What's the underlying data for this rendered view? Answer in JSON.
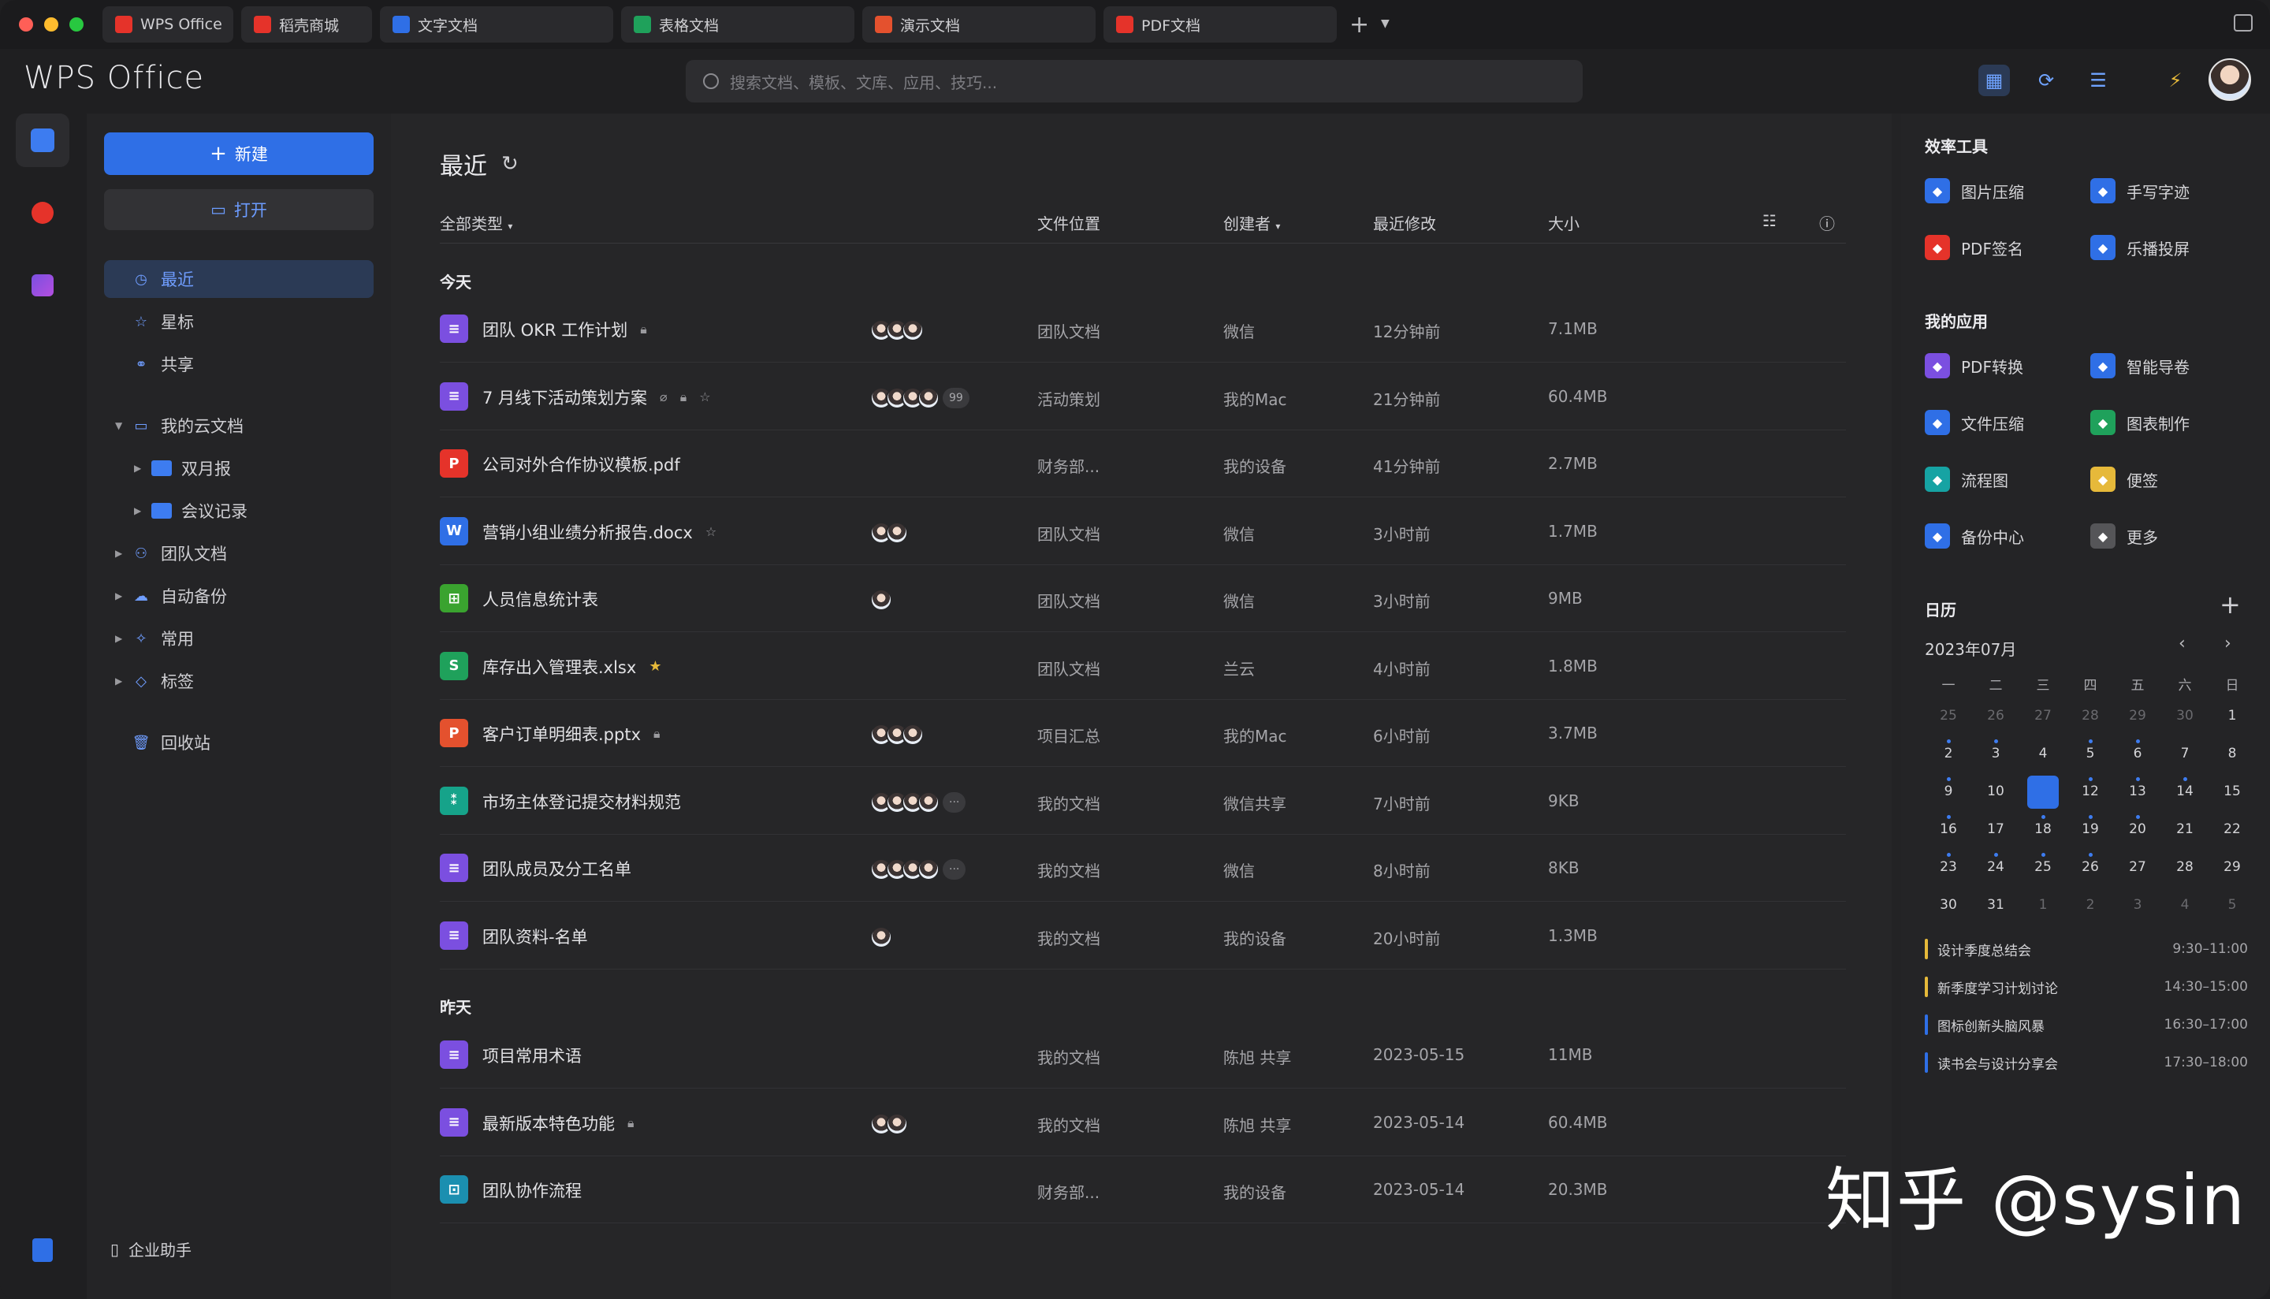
{
  "tabs": [
    {
      "label": "WPS Office",
      "icon": "wps-logo-icon",
      "color": "#e5332a"
    },
    {
      "label": "稻壳商城",
      "icon": "docer-icon",
      "color": "#e5332a"
    },
    {
      "label": "文字文档",
      "icon": "word-doc-icon",
      "color": "#2f6fe6"
    },
    {
      "label": "表格文档",
      "icon": "sheet-doc-icon",
      "color": "#1fa15b"
    },
    {
      "label": "演示文档",
      "icon": "slides-doc-icon",
      "color": "#e4512e"
    },
    {
      "label": "PDF文档",
      "icon": "pdf-doc-icon",
      "color": "#e5332a"
    }
  ],
  "header": {
    "logo": "WPS Office",
    "search_placeholder": "搜索文档、模板、文库、应用、技巧..."
  },
  "sidebar": {
    "new_label": "新建",
    "open_label": "打开",
    "items": {
      "recent": "最近",
      "starred": "星标",
      "shared": "共享",
      "cloud": "我的云文档",
      "weekly": "双月报",
      "meeting": "会议记录",
      "team": "团队文档",
      "backup": "自动备份",
      "common": "常用",
      "tags": "标签",
      "trash": "回收站"
    },
    "enterprise": "企业助手"
  },
  "main": {
    "title": "最近",
    "columns": {
      "type": "全部类型",
      "location": "文件位置",
      "creator": "创建者",
      "modified": "最近修改",
      "size": "大小"
    },
    "group_today": "今天",
    "group_yesterday": "昨天",
    "today": [
      {
        "name": "团队 OKR 工作计划",
        "type": "doc",
        "loc": "团队文档",
        "creator": "微信",
        "time": "12分钟前",
        "size": "7.1MB",
        "avatars": 3,
        "more": "",
        "lock": true,
        "clip": false,
        "star": false,
        "starFilled": false
      },
      {
        "name": "7 月线下活动策划方案",
        "type": "doc",
        "loc": "活动策划",
        "creator": "我的Mac",
        "time": "21分钟前",
        "size": "60.4MB",
        "avatars": 4,
        "more": "99",
        "lock": true,
        "clip": true,
        "star": true,
        "starFilled": false
      },
      {
        "name": "公司对外合作协议模板.pdf",
        "type": "pdf",
        "loc": "财务部...",
        "creator": "我的设备",
        "time": "41分钟前",
        "size": "2.7MB",
        "avatars": 0,
        "more": "",
        "lock": false,
        "clip": false,
        "star": false,
        "starFilled": false
      },
      {
        "name": "营销小组业绩分析报告.docx",
        "type": "word",
        "loc": "团队文档",
        "creator": "微信",
        "time": "3小时前",
        "size": "1.7MB",
        "avatars": 2,
        "more": "",
        "lock": false,
        "clip": false,
        "star": true,
        "starFilled": false
      },
      {
        "name": "人员信息统计表",
        "type": "form",
        "loc": "团队文档",
        "creator": "微信",
        "time": "3小时前",
        "size": "9MB",
        "avatars": 1,
        "more": "",
        "lock": false,
        "clip": false,
        "star": false,
        "starFilled": false
      },
      {
        "name": "库存出入管理表.xlsx",
        "type": "sheet",
        "loc": "团队文档",
        "creator": "兰云",
        "time": "4小时前",
        "size": "1.8MB",
        "avatars": 0,
        "more": "",
        "lock": false,
        "clip": false,
        "star": true,
        "starFilled": true
      },
      {
        "name": "客户订单明细表.pptx",
        "type": "ppt",
        "loc": "项目汇总",
        "creator": "我的Mac",
        "time": "6小时前",
        "size": "3.7MB",
        "avatars": 3,
        "more": "",
        "lock": true,
        "clip": false,
        "star": false,
        "starFilled": false
      },
      {
        "name": "市场主体登记提交材料规范",
        "type": "mind",
        "loc": "我的文档",
        "creator": "微信共享",
        "time": "7小时前",
        "size": "9KB",
        "avatars": 4,
        "more": "···",
        "lock": false,
        "clip": false,
        "star": false,
        "starFilled": false
      },
      {
        "name": "团队成员及分工名单",
        "type": "doc",
        "loc": "我的文档",
        "creator": "微信",
        "time": "8小时前",
        "size": "8KB",
        "avatars": 4,
        "more": "···",
        "lock": false,
        "clip": false,
        "star": false,
        "starFilled": false
      },
      {
        "name": "团队资料-名单",
        "type": "doc",
        "loc": "我的文档",
        "creator": "我的设备",
        "time": "20小时前",
        "size": "1.3MB",
        "avatars": 1,
        "more": "",
        "lock": false,
        "clip": false,
        "star": false,
        "starFilled": false
      }
    ],
    "yesterday": [
      {
        "name": "项目常用术语",
        "type": "doc",
        "loc": "我的文档",
        "creator": "陈旭 共享",
        "time": "2023-05-15",
        "size": "11MB",
        "avatars": 0,
        "more": "",
        "lock": false,
        "clip": false,
        "star": false,
        "starFilled": false
      },
      {
        "name": "最新版本特色功能",
        "type": "doc",
        "loc": "我的文档",
        "creator": "陈旭 共享",
        "time": "2023-05-14",
        "size": "60.4MB",
        "avatars": 2,
        "more": "",
        "lock": true,
        "clip": false,
        "star": false,
        "starFilled": false
      },
      {
        "name": "团队协作流程",
        "type": "flow",
        "loc": "财务部...",
        "creator": "我的设备",
        "time": "2023-05-14",
        "size": "20.3MB",
        "avatars": 0,
        "more": "",
        "lock": false,
        "clip": false,
        "star": false,
        "starFilled": false
      }
    ]
  },
  "right": {
    "efficiency_title": "效率工具",
    "efficiency": [
      {
        "label": "图片压缩",
        "icon": "image-compress-icon",
        "color": "#2f6fe6"
      },
      {
        "label": "手写字迹",
        "icon": "handwriting-icon",
        "color": "#2f6fe6"
      },
      {
        "label": "PDF签名",
        "icon": "pdf-sign-icon",
        "color": "#e5332a"
      },
      {
        "label": "乐播投屏",
        "icon": "screen-cast-icon",
        "color": "#2f6fe6"
      }
    ],
    "apps_title": "我的应用",
    "apps": [
      {
        "label": "PDF转换",
        "icon": "pdf-convert-icon",
        "color": "#7b4fe0"
      },
      {
        "label": "智能导卷",
        "icon": "smart-import-icon",
        "color": "#2f6fe6"
      },
      {
        "label": "文件压缩",
        "icon": "file-compress-icon",
        "color": "#2f6fe6"
      },
      {
        "label": "图表制作",
        "icon": "chart-make-icon",
        "color": "#1fa15b"
      },
      {
        "label": "流程图",
        "icon": "flowchart-icon",
        "color": "#16a3a3"
      },
      {
        "label": "便签",
        "icon": "sticky-note-icon",
        "color": "#e6b93a"
      },
      {
        "label": "备份中心",
        "icon": "backup-center-icon",
        "color": "#2f6fe6"
      },
      {
        "label": "更多",
        "icon": "more-apps-icon",
        "color": "#555558"
      }
    ],
    "calendar_title": "日历",
    "month": "2023年07月",
    "weekdays": [
      "一",
      "二",
      "三",
      "四",
      "五",
      "六",
      "日"
    ],
    "weeks": [
      [
        "25",
        "26",
        "27",
        "28",
        "29",
        "30",
        "1"
      ],
      [
        "2",
        "3",
        "4",
        "5",
        "6",
        "7",
        "8"
      ],
      [
        "9",
        "10",
        "11",
        "12",
        "13",
        "14",
        "15"
      ],
      [
        "16",
        "17",
        "18",
        "19",
        "20",
        "21",
        "22"
      ],
      [
        "23",
        "24",
        "25",
        "26",
        "27",
        "28",
        "29"
      ],
      [
        "30",
        "31",
        "1",
        "2",
        "3",
        "4",
        "5"
      ]
    ],
    "today": "11",
    "events": [
      {
        "name": "设计季度总结会",
        "time": "9:30–11:00",
        "color": "#e6b93a"
      },
      {
        "name": "新季度学习计划讨论",
        "time": "14:30–15:00",
        "color": "#e6b93a"
      },
      {
        "name": "图标创新头脑风暴",
        "time": "16:30–17:00",
        "color": "#2f6fe6"
      },
      {
        "name": "读书会与设计分享会",
        "time": "17:30–18:00",
        "color": "#2f6fe6"
      }
    ]
  },
  "watermark": "知乎 @sysin"
}
